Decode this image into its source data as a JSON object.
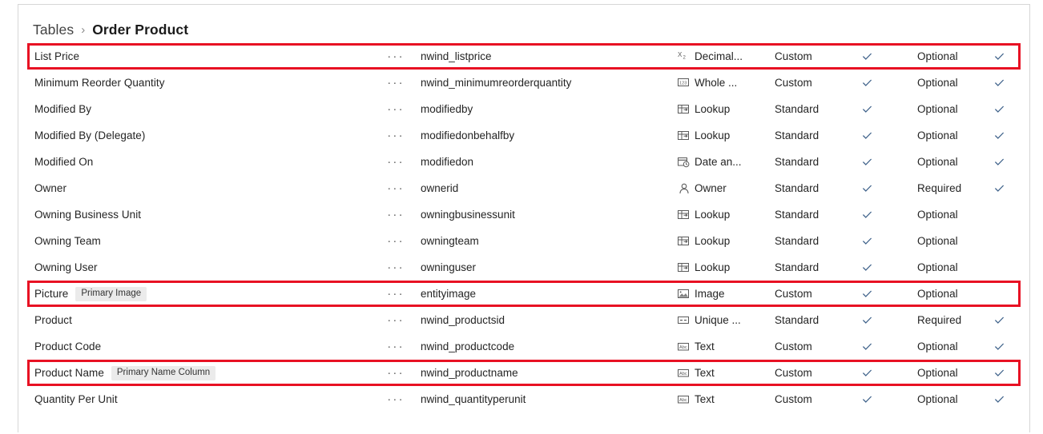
{
  "breadcrumb": {
    "parent": "Tables",
    "separator": "›",
    "current": "Order Product"
  },
  "menu_glyph": "···",
  "colors": {
    "highlight": "#e81123",
    "check": "#3b5f88",
    "badge_bg": "#ebebeb",
    "text": "#242424",
    "border": "#d6d6d6"
  },
  "icons": {
    "menu": "ellipsis-icon",
    "check": "checkmark-icon",
    "decimal": "decimal-number-icon",
    "whole": "whole-number-icon",
    "lookup": "lookup-icon",
    "datetime": "date-and-time-icon",
    "owner": "owner-person-icon",
    "image": "image-icon",
    "unique": "unique-identifier-icon",
    "text": "text-abc-icon"
  },
  "rows": [
    {
      "display_name": "List Price",
      "badge": null,
      "logical_name": "nwind_listprice",
      "data_type": "Decimal...",
      "type_icon": "decimal",
      "custom_type": "Custom",
      "searchable": true,
      "required": "Optional",
      "last_check": true,
      "highlighted": true
    },
    {
      "display_name": "Minimum Reorder Quantity",
      "badge": null,
      "logical_name": "nwind_minimumreorderquantity",
      "data_type": "Whole ...",
      "type_icon": "whole",
      "custom_type": "Custom",
      "searchable": true,
      "required": "Optional",
      "last_check": true,
      "highlighted": false
    },
    {
      "display_name": "Modified By",
      "badge": null,
      "logical_name": "modifiedby",
      "data_type": "Lookup",
      "type_icon": "lookup",
      "custom_type": "Standard",
      "searchable": true,
      "required": "Optional",
      "last_check": true,
      "highlighted": false
    },
    {
      "display_name": "Modified By (Delegate)",
      "badge": null,
      "logical_name": "modifiedonbehalfby",
      "data_type": "Lookup",
      "type_icon": "lookup",
      "custom_type": "Standard",
      "searchable": true,
      "required": "Optional",
      "last_check": true,
      "highlighted": false
    },
    {
      "display_name": "Modified On",
      "badge": null,
      "logical_name": "modifiedon",
      "data_type": "Date an...",
      "type_icon": "datetime",
      "custom_type": "Standard",
      "searchable": true,
      "required": "Optional",
      "last_check": true,
      "highlighted": false
    },
    {
      "display_name": "Owner",
      "badge": null,
      "logical_name": "ownerid",
      "data_type": "Owner",
      "type_icon": "owner",
      "custom_type": "Standard",
      "searchable": true,
      "required": "Required",
      "last_check": true,
      "highlighted": false
    },
    {
      "display_name": "Owning Business Unit",
      "badge": null,
      "logical_name": "owningbusinessunit",
      "data_type": "Lookup",
      "type_icon": "lookup",
      "custom_type": "Standard",
      "searchable": true,
      "required": "Optional",
      "last_check": false,
      "highlighted": false
    },
    {
      "display_name": "Owning Team",
      "badge": null,
      "logical_name": "owningteam",
      "data_type": "Lookup",
      "type_icon": "lookup",
      "custom_type": "Standard",
      "searchable": true,
      "required": "Optional",
      "last_check": false,
      "highlighted": false
    },
    {
      "display_name": "Owning User",
      "badge": null,
      "logical_name": "owninguser",
      "data_type": "Lookup",
      "type_icon": "lookup",
      "custom_type": "Standard",
      "searchable": true,
      "required": "Optional",
      "last_check": false,
      "highlighted": false
    },
    {
      "display_name": "Picture",
      "badge": "Primary Image",
      "logical_name": "entityimage",
      "data_type": "Image",
      "type_icon": "image",
      "custom_type": "Custom",
      "searchable": true,
      "required": "Optional",
      "last_check": false,
      "highlighted": true
    },
    {
      "display_name": "Product",
      "badge": null,
      "logical_name": "nwind_productsid",
      "data_type": "Unique ...",
      "type_icon": "unique",
      "custom_type": "Standard",
      "searchable": true,
      "required": "Required",
      "last_check": true,
      "highlighted": false
    },
    {
      "display_name": "Product Code",
      "badge": null,
      "logical_name": "nwind_productcode",
      "data_type": "Text",
      "type_icon": "text",
      "custom_type": "Custom",
      "searchable": true,
      "required": "Optional",
      "last_check": true,
      "highlighted": false
    },
    {
      "display_name": "Product Name",
      "badge": "Primary Name Column",
      "logical_name": "nwind_productname",
      "data_type": "Text",
      "type_icon": "text",
      "custom_type": "Custom",
      "searchable": true,
      "required": "Optional",
      "last_check": true,
      "highlighted": true
    },
    {
      "display_name": "Quantity Per Unit",
      "badge": null,
      "logical_name": "nwind_quantityperunit",
      "data_type": "Text",
      "type_icon": "text",
      "custom_type": "Custom",
      "searchable": true,
      "required": "Optional",
      "last_check": true,
      "highlighted": false
    }
  ]
}
